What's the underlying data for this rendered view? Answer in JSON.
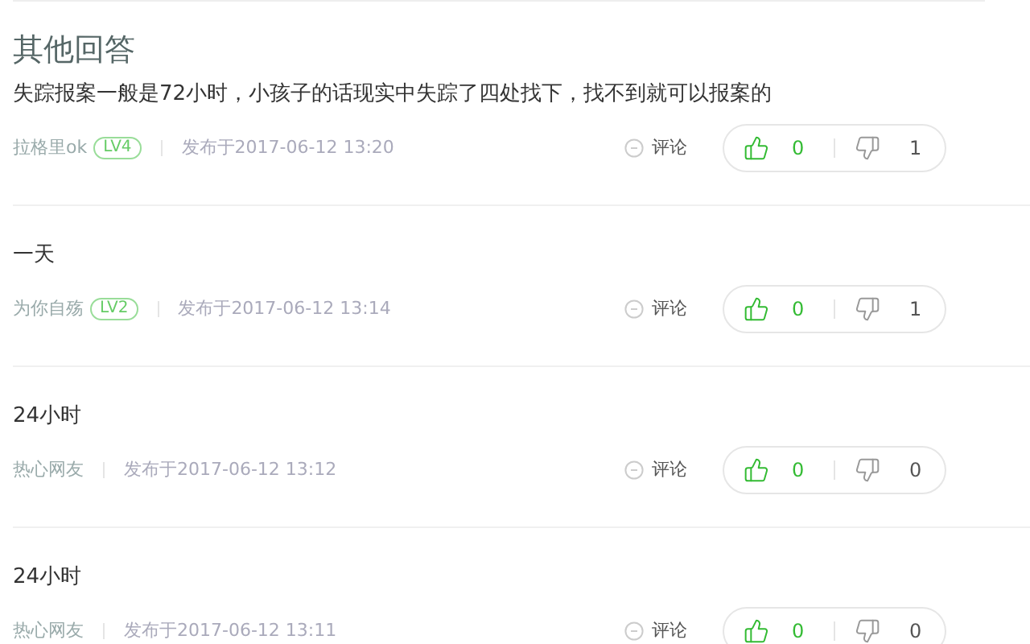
{
  "section_title": "其他回答",
  "answers": [
    {
      "text": "失踪报案一般是72小时，小孩子的话现实中失踪了四处找下，找不到就可以报案的",
      "author": "拉格里ok",
      "level_badge": "LV4",
      "posted": "发布于2017-06-12 13:20",
      "comment_label": "评论",
      "likes": "0",
      "dislikes": "1"
    },
    {
      "text": "一天",
      "author": "为你自殇",
      "level_badge": "LV2",
      "posted": "发布于2017-06-12 13:14",
      "comment_label": "评论",
      "likes": "0",
      "dislikes": "1"
    },
    {
      "text": "24小时",
      "author": "热心网友",
      "posted": "发布于2017-06-12 13:12",
      "comment_label": "评论",
      "likes": "0",
      "dislikes": "0"
    },
    {
      "text": "24小时",
      "author": "热心网友",
      "posted": "发布于2017-06-12 13:11",
      "comment_label": "评论",
      "likes": "0",
      "dislikes": "0"
    }
  ]
}
